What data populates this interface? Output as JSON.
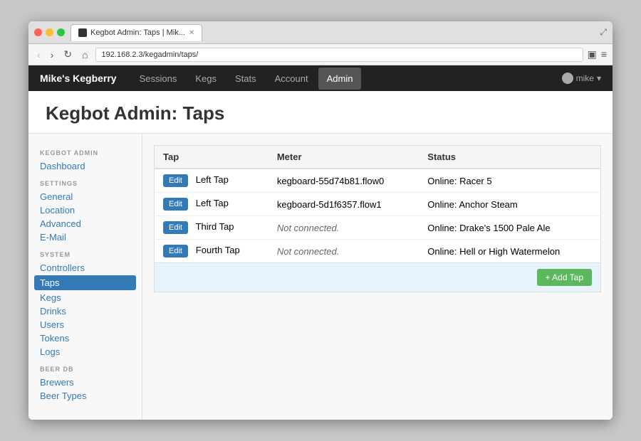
{
  "browser": {
    "tab_title": "Kegbot Admin: Taps | Mik...",
    "url": "192.168.2.3/kegadmin/taps/",
    "favicon_label": "favicon"
  },
  "navbar": {
    "brand": "Mike's Kegberry",
    "links": [
      {
        "label": "Sessions",
        "active": false
      },
      {
        "label": "Kegs",
        "active": false
      },
      {
        "label": "Stats",
        "active": false
      },
      {
        "label": "Account",
        "active": false
      },
      {
        "label": "Admin",
        "active": true
      }
    ],
    "user": "mike"
  },
  "page": {
    "title": "Kegbot Admin: Taps"
  },
  "sidebar": {
    "sections": [
      {
        "label": "KEGBOT ADMIN",
        "items": [
          {
            "label": "Dashboard",
            "active": false
          }
        ]
      },
      {
        "label": "SETTINGS",
        "items": [
          {
            "label": "General",
            "active": false
          },
          {
            "label": "Location",
            "active": false
          },
          {
            "label": "Advanced",
            "active": false
          },
          {
            "label": "E-Mail",
            "active": false
          }
        ]
      },
      {
        "label": "SYSTEM",
        "items": [
          {
            "label": "Controllers",
            "active": false
          },
          {
            "label": "Taps",
            "active": true
          },
          {
            "label": "Kegs",
            "active": false
          },
          {
            "label": "Drinks",
            "active": false
          },
          {
            "label": "Users",
            "active": false
          },
          {
            "label": "Tokens",
            "active": false
          },
          {
            "label": "Logs",
            "active": false
          }
        ]
      },
      {
        "label": "BEER DB",
        "items": [
          {
            "label": "Brewers",
            "active": false
          },
          {
            "label": "Beer Types",
            "active": false
          }
        ]
      }
    ]
  },
  "table": {
    "columns": [
      "Tap",
      "Meter",
      "Status"
    ],
    "rows": [
      {
        "edit_label": "Edit",
        "tap": "Left Tap",
        "meter": "kegboard-55d74b81.flow0",
        "status": "Online: Racer 5",
        "meter_italic": false
      },
      {
        "edit_label": "Edit",
        "tap": "Left Tap",
        "meter": "kegboard-5d1f6357.flow1",
        "status": "Online: Anchor Steam",
        "meter_italic": false
      },
      {
        "edit_label": "Edit",
        "tap": "Third Tap",
        "meter": "Not connected.",
        "status": "Online: Drake's 1500 Pale Ale",
        "meter_italic": true
      },
      {
        "edit_label": "Edit",
        "tap": "Fourth Tap",
        "meter": "Not connected.",
        "status": "Online: Hell or High Watermelon",
        "meter_italic": true
      }
    ],
    "add_button_label": "+ Add Tap"
  }
}
